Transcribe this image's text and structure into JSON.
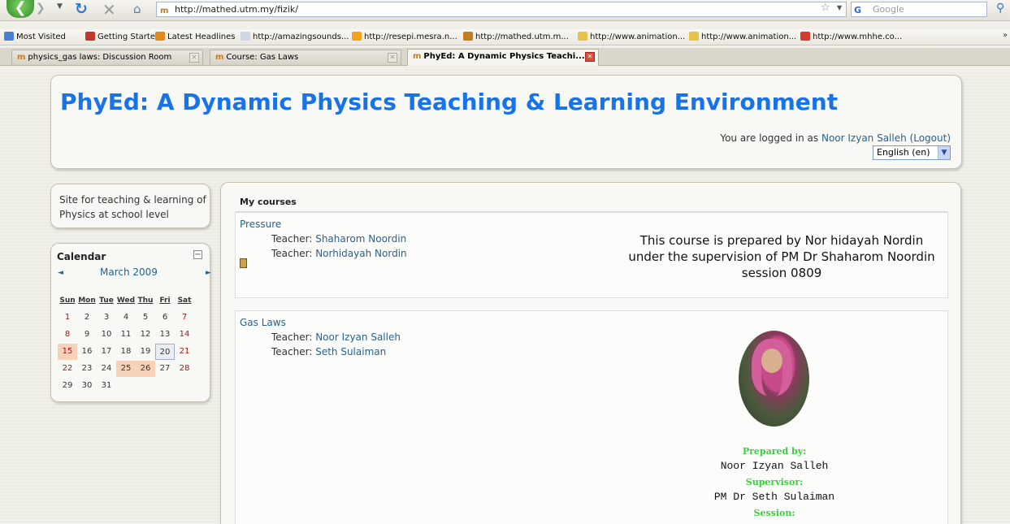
{
  "browser": {
    "url": "http://mathed.utm.my/fizik/",
    "search_placeholder": "Google",
    "bookmarks": [
      {
        "label": "Most Visited",
        "icon_color": "#4a7fd1"
      },
      {
        "label": "Getting Started",
        "icon_color": "#c0392b"
      },
      {
        "label": "Latest Headlines",
        "icon_color": "#e08a1e"
      },
      {
        "label": "http://amazingsounds...",
        "icon_color": "#cfd7e6"
      },
      {
        "label": "http://resepi.mesra.n...",
        "icon_color": "#f0a31c"
      },
      {
        "label": "http://mathed.utm.m...",
        "icon_color": "#c47c1e"
      },
      {
        "label": "http://www.animation...",
        "icon_color": "#e5c24a"
      },
      {
        "label": "http://www.animation...",
        "icon_color": "#e5c24a"
      },
      {
        "label": "http://www.mhhe.co...",
        "icon_color": "#d43a2f"
      }
    ],
    "tabs": [
      {
        "label": "physics_gas laws: Discussion Room"
      },
      {
        "label": "Course: Gas Laws"
      },
      {
        "label": "PhyEd: A Dynamic Physics Teachi...",
        "active": true
      }
    ]
  },
  "header": {
    "title": "PhyEd: A Dynamic Physics Teaching & Learning Environment",
    "logged_in_prefix": "You are logged in as ",
    "user_name": "Noor Izyan Salleh",
    "logout_label": "(Logout)",
    "language": "English (en)"
  },
  "sidebar": {
    "site_description": "Site for teaching & learning of Physics at school level",
    "calendar": {
      "title": "Calendar",
      "month": "March 2009",
      "day_headers": [
        "Sun",
        "Mon",
        "Tue",
        "Wed",
        "Thu",
        "Fri",
        "Sat"
      ],
      "weeks": [
        [
          "1",
          "2",
          "3",
          "4",
          "5",
          "6",
          "7"
        ],
        [
          "8",
          "9",
          "10",
          "11",
          "12",
          "13",
          "14"
        ],
        [
          "15",
          "16",
          "17",
          "18",
          "19",
          "20",
          "21"
        ],
        [
          "22",
          "23",
          "24",
          "25",
          "26",
          "27",
          "28"
        ],
        [
          "29",
          "30",
          "31",
          "",
          "",
          "",
          ""
        ]
      ]
    }
  },
  "main": {
    "heading": "My courses",
    "courses": [
      {
        "name": "Pressure",
        "teachers": [
          {
            "prefix": "Teacher: ",
            "name": "Shaharom Noordin"
          },
          {
            "prefix": "Teacher: ",
            "name": "Norhidayah Nordin"
          }
        ],
        "summary": "This course is prepared by Nor hidayah Nordin under the supervision of PM Dr Shaharom Noordin session 0809"
      },
      {
        "name": "Gas Laws",
        "teachers": [
          {
            "prefix": "Teacher: ",
            "name": "Noor Izyan Salleh"
          },
          {
            "prefix": "Teacher: ",
            "name": "Seth Sulaiman"
          }
        ],
        "prepared_by_label": "Prepared by:",
        "prepared_by": "Noor Izyan Salleh",
        "supervisor_label": "Supervisor:",
        "supervisor": "PM Dr Seth Sulaiman",
        "session_label": "Session:"
      }
    ]
  }
}
